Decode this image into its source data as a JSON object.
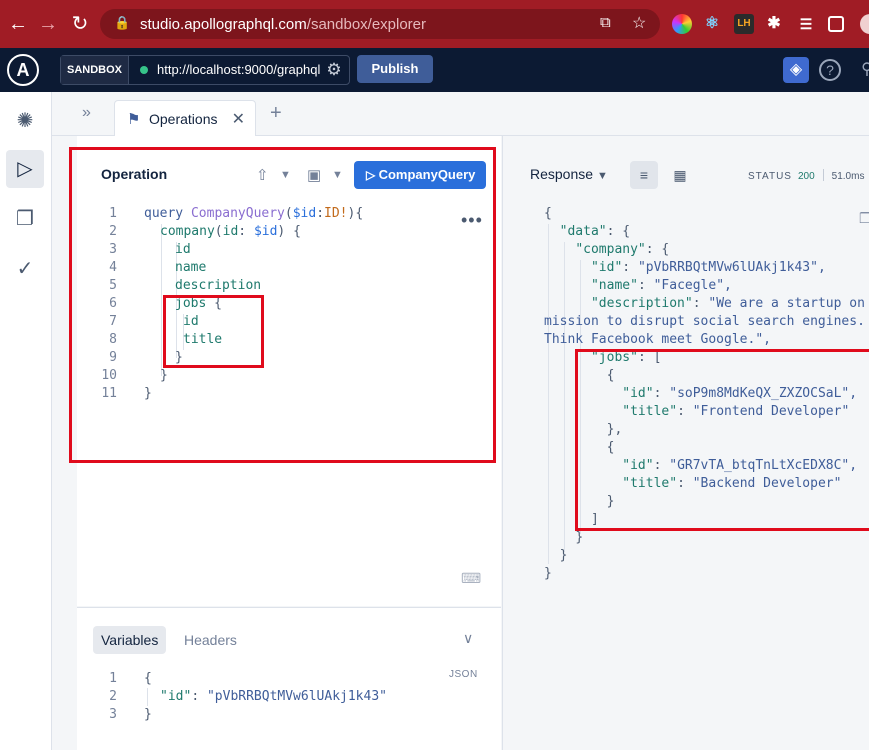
{
  "browser": {
    "url_host": "studio.apollographql.com",
    "url_path": "/sandbox/explorer"
  },
  "header": {
    "sandbox_label": "SANDBOX",
    "endpoint": "http://localhost:9000/graphql",
    "publish_label": "Publish"
  },
  "tabs": {
    "operations_label": "Operations"
  },
  "operation": {
    "title": "Operation",
    "run_label": "CompanyQuery",
    "line_numbers": [
      "1",
      "2",
      "3",
      "4",
      "5",
      "6",
      "7",
      "8",
      "9",
      "10",
      "11"
    ],
    "code": {
      "l1_kw": "query",
      "l1_name": "CompanyQuery",
      "l1_open": "(",
      "l1_var": "$id",
      "l1_colon": ":",
      "l1_type": "ID!",
      "l1_close": "){",
      "l2_field": "company",
      "l2_open": "(",
      "l2_arg": "id",
      "l2_colon": ": ",
      "l2_var": "$id",
      "l2_close": ") {",
      "l3": "id",
      "l4": "name",
      "l5": "description",
      "l6_field": "jobs",
      "l6_brace": " {",
      "l7": "id",
      "l8": "title",
      "l9": "}",
      "l10": "}",
      "l11": "}"
    }
  },
  "variables": {
    "tab_variables": "Variables",
    "tab_headers": "Headers",
    "json_label": "JSON",
    "line_numbers": [
      "1",
      "2",
      "3"
    ],
    "l1": "{",
    "l2_key": "\"id\"",
    "l2_colon": ": ",
    "l2_value": "\"pVbRRBQtMVw6lUAkj1k43\"",
    "l3": "}"
  },
  "response": {
    "title": "Response",
    "status_label": "STATUS",
    "status_code": "200",
    "time": "51.0ms",
    "lines": [
      {
        "indent": "",
        "key": "",
        "sep": "",
        "value": "{"
      },
      {
        "indent": "  ",
        "key": "\"data\"",
        "sep": ": ",
        "value": "{"
      },
      {
        "indent": "    ",
        "key": "\"company\"",
        "sep": ": ",
        "value": "{"
      },
      {
        "indent": "      ",
        "key": "\"id\"",
        "sep": ": ",
        "value": "\"pVbRRBQtMVw6lUAkj1k43\","
      },
      {
        "indent": "      ",
        "key": "\"name\"",
        "sep": ": ",
        "value": "\"Facegle\","
      },
      {
        "indent": "      ",
        "key": "\"description\"",
        "sep": ": ",
        "value": "\"We are a startup on"
      },
      {
        "indent": "",
        "key": "",
        "sep": "",
        "value": "mission to disrupt social search engines."
      },
      {
        "indent": "",
        "key": "",
        "sep": "",
        "value": "Think Facebook meet Google.\","
      },
      {
        "indent": "      ",
        "key": "\"jobs\"",
        "sep": ": ",
        "value": "["
      },
      {
        "indent": "        ",
        "key": "",
        "sep": "",
        "value": "{"
      },
      {
        "indent": "          ",
        "key": "\"id\"",
        "sep": ": ",
        "value": "\"soP9m8MdKeQX_ZXZOCSaL\","
      },
      {
        "indent": "          ",
        "key": "\"title\"",
        "sep": ": ",
        "value": "\"Frontend Developer\""
      },
      {
        "indent": "        ",
        "key": "",
        "sep": "",
        "value": "},"
      },
      {
        "indent": "        ",
        "key": "",
        "sep": "",
        "value": "{"
      },
      {
        "indent": "          ",
        "key": "\"id\"",
        "sep": ": ",
        "value": "\"GR7vTA_btqTnLtXcEDX8C\","
      },
      {
        "indent": "          ",
        "key": "\"title\"",
        "sep": ": ",
        "value": "\"Backend Developer\""
      },
      {
        "indent": "        ",
        "key": "",
        "sep": "",
        "value": "}"
      },
      {
        "indent": "      ",
        "key": "",
        "sep": "",
        "value": "]"
      },
      {
        "indent": "    ",
        "key": "",
        "sep": "",
        "value": "}"
      },
      {
        "indent": "  ",
        "key": "",
        "sep": "",
        "value": "}"
      },
      {
        "indent": "",
        "key": "",
        "sep": "",
        "value": "}"
      }
    ]
  },
  "colors": {
    "browser_bar": "#a01c25",
    "app_header": "#0c1a33",
    "run_button": "#2a6fdb",
    "annotation_red": "#e00b1c"
  },
  "icons": [
    "back-arrow-icon",
    "forward-arrow-icon",
    "reload-icon",
    "lock-icon",
    "share-icon",
    "star-icon",
    "puzzle-icon",
    "apollo-logo",
    "gear-icon",
    "graph-icon",
    "help-icon",
    "bookmark-icon",
    "close-icon",
    "plus-icon",
    "play-icon",
    "share-upload-icon",
    "save-icon",
    "chevron-down-icon",
    "kebab-icon",
    "keyboard-icon",
    "list-view-icon",
    "table-view-icon",
    "copy-icon",
    "check-icon",
    "document-icon",
    "schema-icon"
  ]
}
